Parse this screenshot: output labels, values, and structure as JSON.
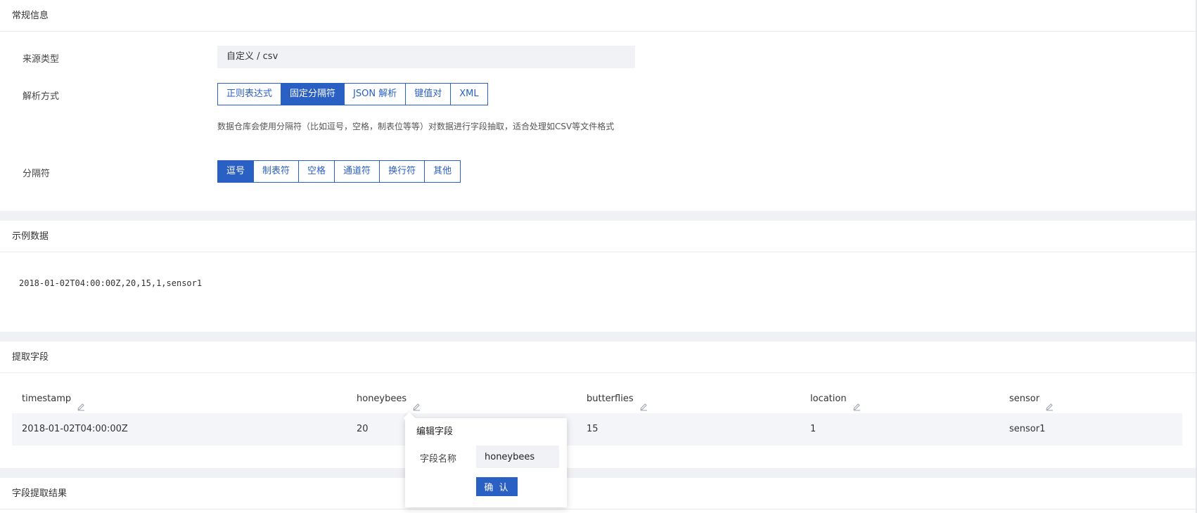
{
  "general": {
    "section_title": "常规信息",
    "source_type_label": "来源类型",
    "source_type_value": "自定义 / csv",
    "parse_method_label": "解析方式",
    "parse_methods": [
      "正则表达式",
      "固定分隔符",
      "JSON 解析",
      "键值对",
      "XML"
    ],
    "parse_method_selected": "固定分隔符",
    "hint": "数据仓库会使用分隔符（比如逗号，空格，制表位等等）对数据进行字段抽取，适合处理如CSV等文件格式",
    "delimiter_label": "分隔符",
    "delimiters": [
      "逗号",
      "制表符",
      "空格",
      "通道符",
      "换行符",
      "其他"
    ],
    "delimiter_selected": "逗号"
  },
  "sample": {
    "section_title": "示例数据",
    "text": "2018-01-02T04:00:00Z,20,15,1,sensor1"
  },
  "extract": {
    "section_title": "提取字段",
    "columns": [
      "timestamp",
      "honeybees",
      "butterflies",
      "location",
      "sensor"
    ],
    "row": [
      "2018-01-02T04:00:00Z",
      "20",
      "15",
      "1",
      "sensor1"
    ]
  },
  "popover": {
    "title": "编辑字段",
    "field_label": "字段名称",
    "field_value": "honeybees",
    "confirm_label": "确 认"
  },
  "result": {
    "section_title": "字段提取结果"
  },
  "colors": {
    "accent": "#2a5fc4",
    "background": "#f0f1f4"
  }
}
